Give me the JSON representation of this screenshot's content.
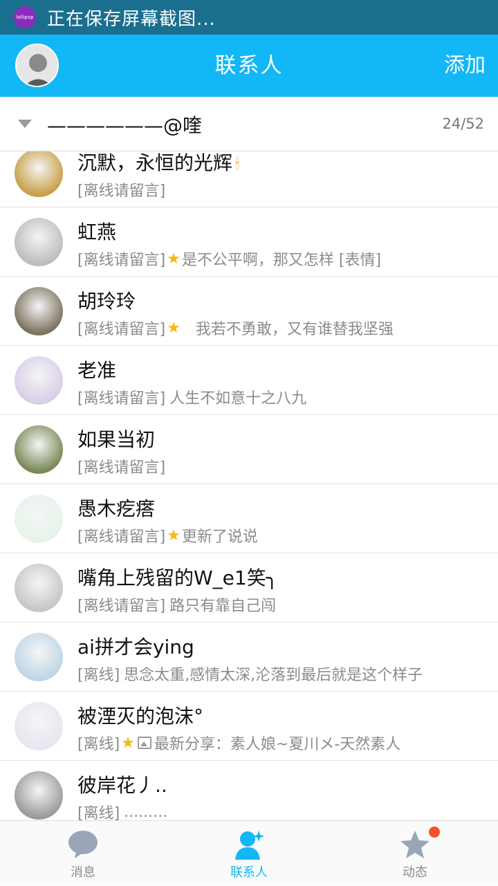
{
  "status_bar": {
    "notification": "正在保存屏幕截图...",
    "app_icon_label": "lollipop"
  },
  "header": {
    "title": "联系人",
    "add_label": "添加"
  },
  "group": {
    "name": "——————@喹",
    "count": "24/52"
  },
  "contacts": [
    {
      "name": "沉默，永恒的光辉",
      "status": "[离线请留言]",
      "message": "",
      "star": false,
      "image": false,
      "torch": true,
      "avatar_color": "#c9a04a"
    },
    {
      "name": "虹燕",
      "status": "[离线请留言]",
      "message": "是不公平啊，那又怎样 [表情]",
      "star": true,
      "image": false,
      "torch": false,
      "avatar_color": "#bdbdbd"
    },
    {
      "name": "胡玲玲",
      "status": "[离线请留言]",
      "message": "我若不勇敢，又有谁替我坚强",
      "star": true,
      "image": false,
      "torch": false,
      "avatar_color": "#7d7460"
    },
    {
      "name": "老准",
      "status": "[离线请留言]",
      "message": "人生不如意十之八九",
      "star": false,
      "image": false,
      "torch": false,
      "avatar_color": "#d8cfe6"
    },
    {
      "name": "如果当初",
      "status": "[离线请留言]",
      "message": "",
      "star": false,
      "image": false,
      "torch": false,
      "avatar_color": "#7a8a58"
    },
    {
      "name": "愚木疙瘩",
      "status": "[离线请留言]",
      "message": "更新了说说",
      "star": true,
      "image": false,
      "torch": false,
      "avatar_color": "#e7f3ea"
    },
    {
      "name": "嘴角上残留的W_e1笑╮",
      "status": "[离线请留言]",
      "message": "路只有靠自己闯",
      "star": false,
      "image": false,
      "torch": false,
      "avatar_color": "#c7c7c7"
    },
    {
      "name": "ai拼才会ying",
      "status": "[离线]",
      "message": "思念太重,感情太深,沦落到最后就是这个样子",
      "star": false,
      "image": false,
      "torch": false,
      "avatar_color": "#bfd6e6"
    },
    {
      "name": "被湮灭的泡沫°",
      "status": "[离线]",
      "message": "最新分享：素人娘~夏川メ-天然素人",
      "star": true,
      "image": true,
      "torch": false,
      "avatar_color": "#e8e6f0"
    },
    {
      "name": "彼岸花丿..",
      "status": "[离线]",
      "message": ".........",
      "star": false,
      "image": false,
      "torch": false,
      "avatar_color": "#9b9b9b"
    }
  ],
  "tabs": [
    {
      "label": "消息",
      "icon": "message-bubble-icon",
      "active": false
    },
    {
      "label": "联系人",
      "icon": "contacts-person-icon",
      "active": true
    },
    {
      "label": "动态",
      "icon": "star-feed-icon",
      "active": false
    }
  ],
  "colors": {
    "accent": "#12b7f5",
    "status_bar": "#1a6f8e",
    "star": "#f5b914",
    "badge": "#f4512c"
  }
}
